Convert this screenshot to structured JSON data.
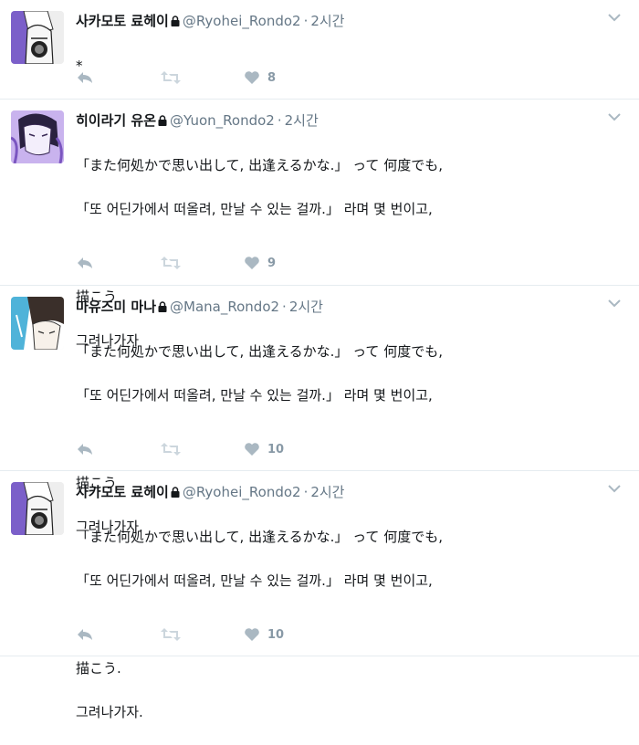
{
  "tweets": [
    {
      "display_name": "사카모토 료헤이",
      "handle": "@Ryohei_Rondo2",
      "separator": "·",
      "time": "2시간",
      "lines": [
        "*"
      ],
      "like_count": "8",
      "avatar_icon": "avatar-ryohei"
    },
    {
      "display_name": "히이라기 유온",
      "handle": "@Yuon_Rondo2",
      "separator": "·",
      "time": "2시간",
      "lines": [
        "「また何処かで思い出して, 出逢えるかな.」 って 何度でも,",
        "「또 어딘가에서 떠올려, 만날 수 있는 걸까.」 라며 몇 번이고,",
        "",
        "描こう",
        "그려나가자"
      ],
      "like_count": "9",
      "avatar_icon": "avatar-yuon"
    },
    {
      "display_name": "마유즈미 마나",
      "handle": "@Mana_Rondo2",
      "separator": "·",
      "time": "2시간",
      "lines": [
        "「また何処かで思い出して, 出逢えるかな.」 って 何度でも,",
        "「또 어딘가에서 떠올려, 만날 수 있는 걸까.」 라며 몇 번이고,",
        "",
        "描こう",
        "그려나가자."
      ],
      "like_count": "10",
      "avatar_icon": "avatar-mana"
    },
    {
      "display_name": "사카모토 료헤이",
      "handle": "@Ryohei_Rondo2",
      "separator": "·",
      "time": "2시간",
      "lines": [
        "「また何処かで思い出して, 出逢えるかな.」 って 何度でも,",
        "「또 어딘가에서 떠올려, 만날 수 있는 걸까.」 라며 몇 번이고,",
        "",
        "描こう.",
        "그려나가자."
      ],
      "like_count": "10",
      "avatar_icon": "avatar-ryohei"
    }
  ],
  "colors": {
    "action_gray": "#aab8c2",
    "text_secondary": "#657786",
    "border": "#e6ecf0"
  }
}
